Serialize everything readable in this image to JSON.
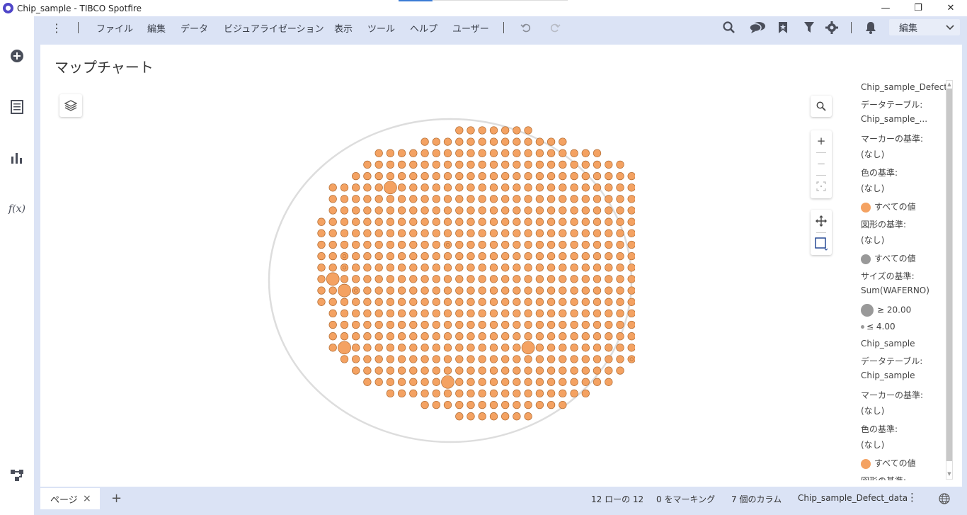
{
  "window": {
    "title": "Chip_sample - TIBCO Spotfire",
    "minimize": "—",
    "maximize": "❐",
    "close": "✕"
  },
  "menu": {
    "items": [
      "ファイル",
      "編集",
      "データ",
      "ビジュアライゼーション",
      "表示",
      "ツール",
      "ヘルプ",
      "ユーザー"
    ],
    "mode": "編集"
  },
  "viz": {
    "title": "マップチャート"
  },
  "legend": {
    "items": [
      "Chip_sample_Defect_d",
      "データテーブル:",
      "Chip_sample_...",
      "マーカーの基準:",
      "(なし)",
      "色の基準:",
      "(なし)",
      "すべての値",
      "図形の基準:",
      "(なし)",
      "すべての値",
      "サイズの基準:",
      "Sum(WAFERNO)",
      "≥ 20.00",
      "≤ 4.00",
      "Chip_sample",
      "データテーブル:",
      "Chip_sample",
      "マーカーの基準:",
      "(なし)",
      "色の基準:",
      "(なし)",
      "すべての値",
      "図形の基準:"
    ]
  },
  "status": {
    "page_tab": "ページ",
    "page_close": "×",
    "add_page": "+",
    "rows": "12 ローの 12",
    "marked": "0 をマーキング",
    "columns": "7 個のカラム",
    "table": "Chip_sample_Defect_data"
  },
  "colors": {
    "marker": "#f4a262",
    "marker_stroke": "#b06a30",
    "gray_swatch": "#999999",
    "wafer_outline": "#dddddd",
    "frame": "#dbe3f5"
  },
  "map": {
    "marker_size_by": "Sum(WAFERNO)",
    "size_legend_max": 20.0,
    "size_legend_min": 4.0
  }
}
